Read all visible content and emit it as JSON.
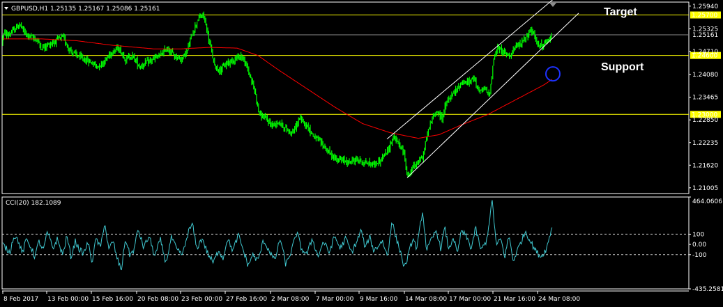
{
  "chart_data": [
    {
      "type": "line",
      "header": {
        "symbol": "GBPUSD,H1",
        "open": "1.25135",
        "high": "1.25167",
        "low": "1.25086",
        "close": "1.25161"
      },
      "y_ticks": [
        "1.25940",
        "1.25325",
        "1.24710",
        "1.24080",
        "1.23465",
        "1.22850",
        "1.22235",
        "1.21620",
        "1.21005"
      ],
      "ylim": [
        1.2085,
        1.2605
      ],
      "current_price_label": "1.25161",
      "hlines": [
        {
          "value": 1.257,
          "label": "1.25700",
          "color": "#ffff00"
        },
        {
          "value": 1.246,
          "label": "1.24600",
          "color": "#ffff00"
        },
        {
          "value": 1.23,
          "label": "1.23000",
          "color": "#ffff00"
        },
        {
          "value": 1.25161,
          "label": "",
          "color": "#8c8c8c"
        }
      ],
      "annotations": {
        "target": "Target",
        "support": "Support"
      },
      "price_keypoints": [
        [
          0,
          1.2495
        ],
        [
          6,
          1.252
        ],
        [
          12,
          1.2515
        ],
        [
          18,
          1.2525
        ],
        [
          28,
          1.2545
        ],
        [
          36,
          1.252
        ],
        [
          44,
          1.251
        ],
        [
          52,
          1.2505
        ],
        [
          60,
          1.248
        ],
        [
          70,
          1.249
        ],
        [
          80,
          1.25
        ],
        [
          90,
          1.251
        ],
        [
          100,
          1.2475
        ],
        [
          110,
          1.246
        ],
        [
          120,
          1.245
        ],
        [
          132,
          1.244
        ],
        [
          140,
          1.243
        ],
        [
          150,
          1.2445
        ],
        [
          160,
          1.247
        ],
        [
          170,
          1.248
        ],
        [
          180,
          1.245
        ],
        [
          190,
          1.246
        ],
        [
          200,
          1.243
        ],
        [
          210,
          1.244
        ],
        [
          220,
          1.245
        ],
        [
          230,
          1.246
        ],
        [
          240,
          1.248
        ],
        [
          250,
          1.246
        ],
        [
          260,
          1.245
        ],
        [
          268,
          1.247
        ],
        [
          276,
          1.252
        ],
        [
          284,
          1.256
        ],
        [
          292,
          1.257
        ],
        [
          300,
          1.25
        ],
        [
          308,
          1.243
        ],
        [
          316,
          1.242
        ],
        [
          326,
          1.244
        ],
        [
          336,
          1.245
        ],
        [
          346,
          1.246
        ],
        [
          356,
          1.242
        ],
        [
          366,
          1.236
        ],
        [
          372,
          1.23
        ],
        [
          380,
          1.229
        ],
        [
          390,
          1.227
        ],
        [
          400,
          1.228
        ],
        [
          410,
          1.226
        ],
        [
          420,
          1.225
        ],
        [
          430,
          1.229
        ],
        [
          440,
          1.227
        ],
        [
          450,
          1.224
        ],
        [
          460,
          1.2225
        ],
        [
          470,
          1.22
        ],
        [
          480,
          1.218
        ],
        [
          490,
          1.2175
        ],
        [
          500,
          1.217
        ],
        [
          512,
          1.2178
        ],
        [
          524,
          1.2168
        ],
        [
          536,
          1.2165
        ],
        [
          546,
          1.2175
        ],
        [
          556,
          1.22
        ],
        [
          564,
          1.224
        ],
        [
          572,
          1.222
        ],
        [
          580,
          1.219
        ],
        [
          585,
          1.213
        ],
        [
          590,
          1.215
        ],
        [
          598,
          1.217
        ],
        [
          606,
          1.218
        ],
        [
          612,
          1.224
        ],
        [
          618,
          1.228
        ],
        [
          626,
          1.231
        ],
        [
          634,
          1.229
        ],
        [
          640,
          1.233
        ],
        [
          648,
          1.235
        ],
        [
          656,
          1.237
        ],
        [
          664,
          1.239
        ],
        [
          672,
          1.2385
        ],
        [
          680,
          1.24
        ],
        [
          688,
          1.236
        ],
        [
          696,
          1.237
        ],
        [
          702,
          1.235
        ],
        [
          708,
          1.245
        ],
        [
          714,
          1.248
        ],
        [
          722,
          1.247
        ],
        [
          730,
          1.246
        ],
        [
          738,
          1.248
        ],
        [
          746,
          1.249
        ],
        [
          754,
          1.251
        ],
        [
          762,
          1.253
        ],
        [
          770,
          1.2495
        ],
        [
          778,
          1.2485
        ],
        [
          786,
          1.25
        ],
        [
          792,
          1.2516
        ]
      ],
      "ma_keypoints": [
        [
          0,
          1.2505
        ],
        [
          60,
          1.2505
        ],
        [
          110,
          1.25
        ],
        [
          160,
          1.2488
        ],
        [
          220,
          1.2478
        ],
        [
          260,
          1.2478
        ],
        [
          300,
          1.2482
        ],
        [
          340,
          1.248
        ],
        [
          370,
          1.246
        ],
        [
          400,
          1.242
        ],
        [
          440,
          1.237
        ],
        [
          480,
          1.232
        ],
        [
          520,
          1.2275
        ],
        [
          560,
          1.225
        ],
        [
          600,
          1.2235
        ],
        [
          630,
          1.2245
        ],
        [
          660,
          1.227
        ],
        [
          700,
          1.23
        ],
        [
          740,
          1.234
        ],
        [
          780,
          1.238
        ],
        [
          792,
          1.2395
        ]
      ],
      "ma_color": "#ff0000",
      "price_color": "#00ff00",
      "channel_lines": [
        {
          "from": [
            584,
            1.2128
          ],
          "to": [
            830,
            1.2575
          ]
        },
        {
          "from": [
            555,
            1.2233
          ],
          "to": [
            795,
            1.2615
          ]
        }
      ],
      "marker_circle": {
        "x": 793,
        "y": 1.241
      },
      "x_tick_labels": [
        "8 Feb 2017",
        "13 Feb 00:00",
        "15 Feb 16:00",
        "20 Feb 08:00",
        "23 Feb 00:00",
        "27 Feb 16:00",
        "2 Mar 08:00",
        "7 Mar 00:00",
        "9 Mar 16:00",
        "14 Mar 08:00",
        "17 Mar 00:00",
        "21 Mar 16:00",
        "24 Mar 08:00"
      ],
      "x_tick_positions": [
        4,
        67,
        131,
        196,
        259,
        323,
        388,
        452,
        515,
        580,
        643,
        707,
        771
      ]
    },
    {
      "type": "line",
      "indicator_label": "CCI(20) 182.1089",
      "y_tick_labels": [
        "464.0606",
        "100",
        "0.00",
        "-100",
        "-435.2581"
      ],
      "ylim": [
        -435.2581,
        464.0606
      ],
      "levels": [
        100,
        -100
      ],
      "level_color": "#c8c8c8",
      "line_color": "#40c8d0",
      "cci_keypoints": [
        [
          4,
          0
        ],
        [
          14,
          -80
        ],
        [
          20,
          90
        ],
        [
          26,
          40
        ],
        [
          32,
          -90
        ],
        [
          38,
          50
        ],
        [
          44,
          -20
        ],
        [
          50,
          -120
        ],
        [
          56,
          30
        ],
        [
          62,
          -60
        ],
        [
          68,
          120
        ],
        [
          76,
          -40
        ],
        [
          82,
          50
        ],
        [
          90,
          -100
        ],
        [
          96,
          80
        ],
        [
          102,
          -130
        ],
        [
          108,
          30
        ],
        [
          114,
          -50
        ],
        [
          120,
          -90
        ],
        [
          126,
          20
        ],
        [
          132,
          -170
        ],
        [
          138,
          60
        ],
        [
          144,
          -40
        ],
        [
          150,
          220
        ],
        [
          156,
          -60
        ],
        [
          162,
          40
        ],
        [
          168,
          -140
        ],
        [
          174,
          -250
        ],
        [
          180,
          60
        ],
        [
          186,
          -100
        ],
        [
          192,
          -60
        ],
        [
          198,
          150
        ],
        [
          206,
          -30
        ],
        [
          214,
          80
        ],
        [
          222,
          -120
        ],
        [
          230,
          50
        ],
        [
          238,
          -180
        ],
        [
          246,
          70
        ],
        [
          254,
          -60
        ],
        [
          262,
          -100
        ],
        [
          270,
          120
        ],
        [
          276,
          200
        ],
        [
          282,
          -40
        ],
        [
          290,
          60
        ],
        [
          298,
          -90
        ],
        [
          306,
          -180
        ],
        [
          314,
          -50
        ],
        [
          320,
          -140
        ],
        [
          326,
          60
        ],
        [
          334,
          -60
        ],
        [
          342,
          90
        ],
        [
          350,
          -80
        ],
        [
          356,
          -210
        ],
        [
          362,
          -100
        ],
        [
          370,
          -160
        ],
        [
          378,
          40
        ],
        [
          386,
          -60
        ],
        [
          394,
          -160
        ],
        [
          402,
          60
        ],
        [
          410,
          -200
        ],
        [
          418,
          -60
        ],
        [
          426,
          120
        ],
        [
          432,
          -40
        ],
        [
          440,
          -100
        ],
        [
          448,
          60
        ],
        [
          456,
          -120
        ],
        [
          464,
          30
        ],
        [
          472,
          -80
        ],
        [
          480,
          80
        ],
        [
          488,
          -40
        ],
        [
          496,
          60
        ],
        [
          504,
          -80
        ],
        [
          512,
          30
        ],
        [
          518,
          140
        ],
        [
          524,
          -40
        ],
        [
          530,
          80
        ],
        [
          536,
          -60
        ],
        [
          542,
          -20
        ],
        [
          548,
          40
        ],
        [
          556,
          -120
        ],
        [
          562,
          240
        ],
        [
          568,
          60
        ],
        [
          574,
          -60
        ],
        [
          580,
          -230
        ],
        [
          586,
          -100
        ],
        [
          592,
          60
        ],
        [
          598,
          -40
        ],
        [
          606,
          330
        ],
        [
          612,
          -60
        ],
        [
          620,
          60
        ],
        [
          626,
          140
        ],
        [
          632,
          -40
        ],
        [
          638,
          160
        ],
        [
          644,
          -60
        ],
        [
          650,
          80
        ],
        [
          656,
          -100
        ],
        [
          662,
          140
        ],
        [
          670,
          60
        ],
        [
          676,
          -40
        ],
        [
          682,
          160
        ],
        [
          690,
          -60
        ],
        [
          698,
          40
        ],
        [
          706,
          430
        ],
        [
          712,
          -20
        ],
        [
          718,
          60
        ],
        [
          724,
          -120
        ],
        [
          730,
          90
        ],
        [
          736,
          -160
        ],
        [
          742,
          -60
        ],
        [
          748,
          40
        ],
        [
          754,
          130
        ],
        [
          760,
          40
        ],
        [
          768,
          -60
        ],
        [
          776,
          -120
        ],
        [
          784,
          -40
        ],
        [
          792,
          182
        ]
      ]
    }
  ]
}
